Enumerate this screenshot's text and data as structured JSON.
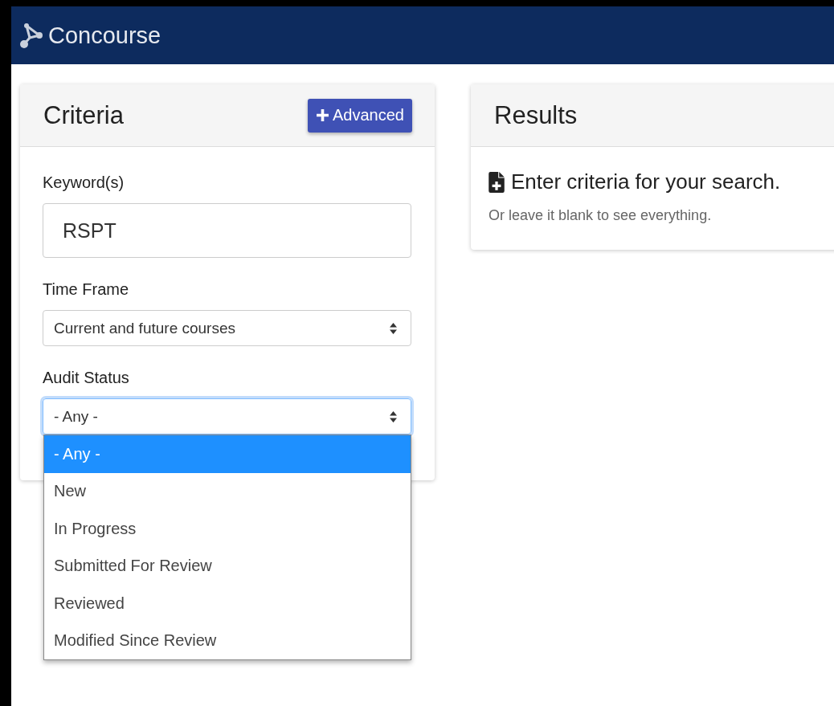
{
  "header": {
    "brand": "Concourse"
  },
  "criteria": {
    "title": "Criteria",
    "advanced_button": "Advanced",
    "fields": [
      {
        "kind": "text",
        "label": "Keyword(s)",
        "value": "RSPT"
      },
      {
        "kind": "select",
        "label": "Time Frame",
        "value": "Current and future courses",
        "focused": false
      },
      {
        "kind": "select",
        "label": "Audit Status",
        "value": "- Any -",
        "focused": true,
        "options": [
          {
            "label": "- Any -",
            "selected": true
          },
          {
            "label": "New",
            "selected": false
          },
          {
            "label": "In Progress",
            "selected": false
          },
          {
            "label": "Submitted For Review",
            "selected": false
          },
          {
            "label": "Reviewed",
            "selected": false
          },
          {
            "label": "Modified Since Review",
            "selected": false
          }
        ]
      }
    ]
  },
  "results": {
    "title": "Results",
    "heading": "Enter criteria for your search.",
    "hint": "Or leave it blank to see everything."
  }
}
